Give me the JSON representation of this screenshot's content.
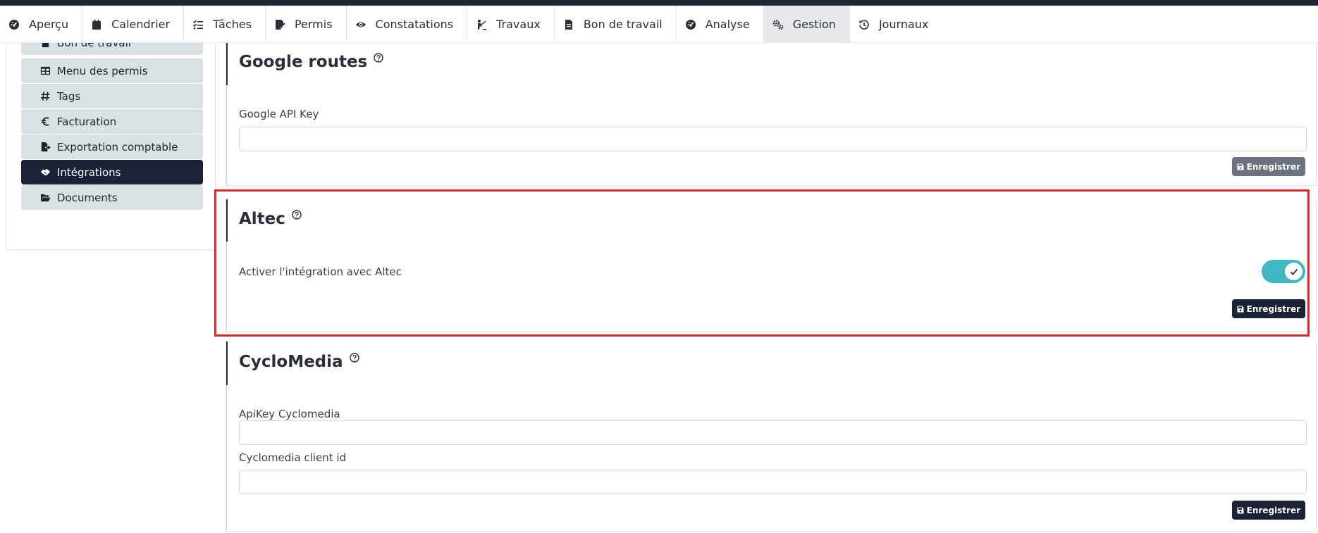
{
  "nav": {
    "items": [
      {
        "label": "Aperçu",
        "icon": "dashboard-icon"
      },
      {
        "label": "Calendrier",
        "icon": "calendar-icon"
      },
      {
        "label": "Tâches",
        "icon": "tasks-icon"
      },
      {
        "label": "Permis",
        "icon": "permit-icon"
      },
      {
        "label": "Constatations",
        "icon": "eye-icon"
      },
      {
        "label": "Travaux",
        "icon": "worker-icon"
      },
      {
        "label": "Bon de travail",
        "icon": "document-icon"
      },
      {
        "label": "Analyse",
        "icon": "gauge-icon"
      },
      {
        "label": "Gestion",
        "icon": "gears-icon"
      },
      {
        "label": "Journaux",
        "icon": "history-icon"
      }
    ],
    "active": "Gestion"
  },
  "sidebar": {
    "items": [
      {
        "label": "Bon de travail",
        "icon": "document-icon"
      },
      {
        "label": "Menu des permis",
        "icon": "table-icon"
      },
      {
        "label": "Tags",
        "icon": "hashtag-icon"
      },
      {
        "label": "Facturation",
        "icon": "euro-icon"
      },
      {
        "label": "Exportation comptable",
        "icon": "file-export-icon"
      },
      {
        "label": "Intégrations",
        "icon": "handshake-icon"
      },
      {
        "label": "Documents",
        "icon": "folder-open-icon"
      }
    ],
    "active": "Intégrations"
  },
  "sections": {
    "google": {
      "title": "Google routes",
      "api_key_label": "Google API Key",
      "api_key_value": "",
      "save_label": "Enregistrer"
    },
    "altec": {
      "title": "Altec",
      "enable_label": "Activer l'intégration avec Altec",
      "enabled": true,
      "save_label": "Enregistrer"
    },
    "cyclomedia": {
      "title": "CycloMedia",
      "api_key_label": "ApiKey Cyclomedia",
      "api_key_value": "",
      "client_id_label": "Cyclomedia client id",
      "client_id_value": "",
      "save_label": "Enregistrer"
    }
  },
  "colors": {
    "navy": "#1b2236",
    "toggle_on": "#3fb8c2",
    "sidebar_item": "#d9e1e2",
    "highlight": "#e0262b",
    "muted_button": "#6c7380"
  }
}
